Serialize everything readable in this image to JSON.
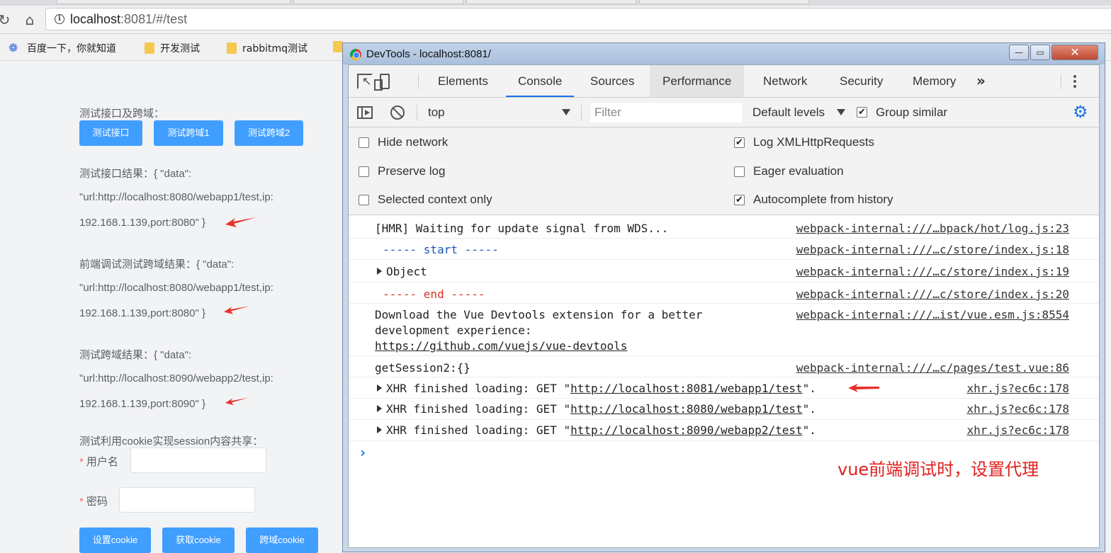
{
  "browser": {
    "url_host": "localhost",
    "url_rest": ":8081/#/test",
    "bookmarks": [
      "百度一下，你就知道",
      "开发测试",
      "rabbitmq测试"
    ]
  },
  "page": {
    "section1_title": "测试接口及跨域：",
    "buttons_top": [
      "测试接口",
      "测试跨域1",
      "测试跨域2"
    ],
    "result1": [
      "测试接口结果：{ \"data\":",
      "\"url:http://localhost:8080/webapp1/test,ip:",
      "192.168.1.139,port:8080\" }"
    ],
    "result2": [
      "前端调试测试跨域结果：{ \"data\":",
      "\"url:http://localhost:8080/webapp1/test,ip:",
      "192.168.1.139,port:8080\" }"
    ],
    "result3": [
      "测试跨域结果：{ \"data\":",
      "\"url:http://localhost:8090/webapp2/test,ip:",
      "192.168.1.139,port:8090\" }"
    ],
    "section2_title": "测试利用cookie实现session内容共享：",
    "username_label": "用户名",
    "password_label": "密码",
    "required_mark": "*",
    "buttons_bottom": [
      "设置cookie",
      "获取cookie",
      "跨域cookie"
    ]
  },
  "devtools": {
    "window_title": "DevTools - localhost:8081/",
    "window_buttons": {
      "minimize": "—",
      "maximize": "▭",
      "close": "✕"
    },
    "tabs": [
      "Elements",
      "Console",
      "Sources",
      "Performance",
      "Network",
      "Security",
      "Memory"
    ],
    "active_tab": "Console",
    "more_tabs": "»",
    "context": "top",
    "filter_placeholder": "Filter",
    "levels": "Default levels",
    "group_similar": "Group similar",
    "settings": [
      {
        "label": "Hide network",
        "checked": false
      },
      {
        "label": "Log XMLHttpRequests",
        "checked": true
      },
      {
        "label": "Preserve log",
        "checked": false
      },
      {
        "label": "Eager evaluation",
        "checked": false
      },
      {
        "label": "Selected context only",
        "checked": false
      },
      {
        "label": "Autocomplete from history",
        "checked": true
      }
    ],
    "console": {
      "rows": [
        {
          "text": "[HMR] Waiting for update signal from WDS...",
          "source": "webpack-internal:///…bpack/hot/log.js:23"
        },
        {
          "text": "----- start -----",
          "source": "webpack-internal:///…c/store/index.js:18"
        },
        {
          "text": "Object",
          "source": "webpack-internal:///…c/store/index.js:19"
        },
        {
          "text": "----- end -----",
          "source": "webpack-internal:///…c/store/index.js:20"
        },
        {
          "text": "Download the Vue Devtools extension for a better",
          "text2": "development experience:",
          "link": "https://github.com/vuejs/vue-devtools",
          "source": "webpack-internal:///…ist/vue.esm.js:8554"
        },
        {
          "text": "getSession2:{}",
          "source": "webpack-internal:///…c/pages/test.vue:86"
        },
        {
          "prefix": "XHR finished loading: GET \"",
          "url": "http://localhost:8081/webapp1/test",
          "suffix": "\".",
          "source": "xhr.js?ec6c:178"
        },
        {
          "prefix": "XHR finished loading: GET \"",
          "url": "http://localhost:8080/webapp1/test",
          "suffix": "\".",
          "source": "xhr.js?ec6c:178"
        },
        {
          "prefix": "XHR finished loading: GET \"",
          "url": "http://localhost:8090/webapp2/test",
          "suffix": "\".",
          "source": "xhr.js?ec6c:178"
        }
      ],
      "prompt": "›"
    },
    "annotation": "vue前端调试时，设置代理"
  },
  "colors": {
    "primary_button": "#409eff",
    "annotation_red": "#e02020",
    "arrow_red": "#e8302a",
    "tab_underline": "#1a73e8"
  }
}
